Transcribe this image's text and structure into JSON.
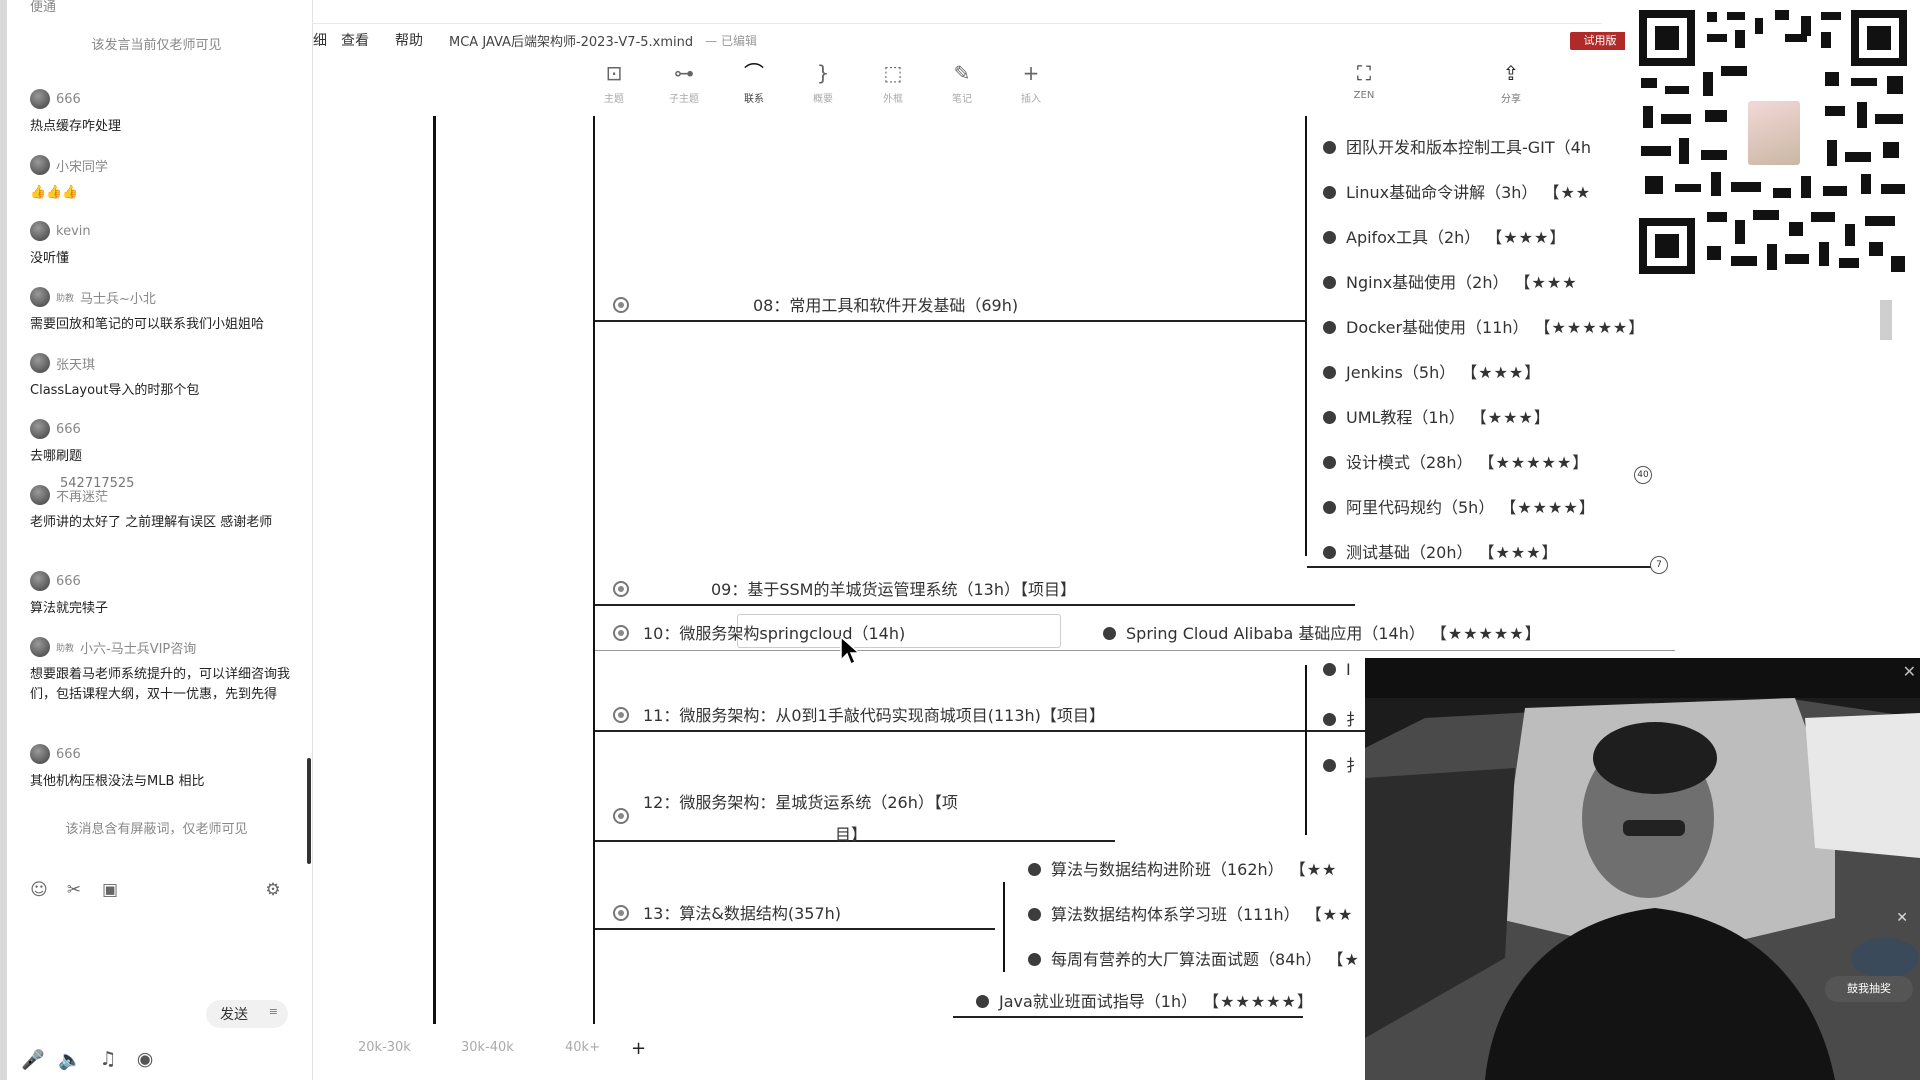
{
  "chat": {
    "notice_top": "该发言当前仅老师可见",
    "fragment_top": "便通",
    "messages": [
      {
        "user": "666",
        "tag": "",
        "text": "热点缓存咋处理"
      },
      {
        "user": "小宋同学",
        "tag": "",
        "text": "👍👍👍"
      },
      {
        "user": "kevin",
        "tag": "",
        "text": "没听懂"
      },
      {
        "user": "马士兵~小北",
        "tag": "助教",
        "text": "需要回放和笔记的可以联系我们小姐姐哈"
      },
      {
        "user": "张天琪",
        "tag": "",
        "text": "ClassLayout导入的时那个包"
      },
      {
        "user": "666",
        "tag": "",
        "text": "去哪刷题"
      },
      {
        "user": "不再迷茫",
        "tag": "",
        "text": "老师讲的太好了 之前理解有误区 感谢老师"
      },
      {
        "user": "666",
        "tag": "",
        "text": "算法就完犊子"
      },
      {
        "user": "小六-马士兵VIP咨询",
        "tag": "助教",
        "text": "想要跟着马老师系统提升的，可以详细咨询我们，包括课程大纲，双十一优惠，先到先得"
      },
      {
        "user": "666",
        "tag": "",
        "text": "其他机构压根没法与MLB 相比"
      }
    ],
    "overlap_number": "542717525",
    "notice_bottom": "该消息含有屏蔽词，仅老师可见",
    "send_label": "发送",
    "send_arrow": "≡",
    "emoji_icon": "☺",
    "scissors_icon": "✂",
    "image_icon": "▣",
    "settings_icon": "⚙",
    "mic_icon": "🎤",
    "speaker_icon": "🔈",
    "music_icon": "♫",
    "pin_icon": "◉"
  },
  "app": {
    "menu": [
      "查看",
      "帮助"
    ],
    "menu_fragment": "细",
    "doc_title": "MCA JAVA后端架构师-2023-V7-5.xmind",
    "doc_status": "— 已编辑",
    "trial_label": "试用版",
    "tools": [
      {
        "icon": "⊡",
        "label": "主题"
      },
      {
        "icon": "⊶",
        "label": "子主题"
      },
      {
        "icon": "⌒",
        "label": "联系"
      },
      {
        "icon": "}",
        "label": "概要"
      },
      {
        "icon": "⬚",
        "label": "外框"
      },
      {
        "icon": "✎",
        "label": "笔记"
      },
      {
        "icon": "+",
        "label": "插入"
      },
      {
        "icon": "⛶",
        "label": "ZEN"
      },
      {
        "icon": "⇪",
        "label": "分享"
      }
    ]
  },
  "mindmap": {
    "branches": [
      {
        "label": "08：常用工具和软件开发基础（69h)"
      },
      {
        "label": "09：基于SSM的羊城货运管理系统（13h）【项目】"
      },
      {
        "label": "10：微服务架构springcloud（14h)"
      },
      {
        "label": "11：微服务架构：从0到1手敲代码实现商城项目(113h)【项目】"
      },
      {
        "label": "12：微服务架构：星城货运系统（26h）【项"
      },
      {
        "label": "目】"
      },
      {
        "label": "13：算法&数据结构(357h)"
      }
    ],
    "tool_children": [
      {
        "label": "团队开发和版本控制工具-GIT（4h",
        "stars": ""
      },
      {
        "label": "Linux基础命令讲解（3h）",
        "stars": "【★★"
      },
      {
        "label": "Apifox工具（2h）",
        "stars": "【★★★】"
      },
      {
        "label": "Nginx基础使用（2h）",
        "stars": "【★★★"
      },
      {
        "label": "Docker基础使用（11h）",
        "stars": "【★★★★★】"
      },
      {
        "label": "Jenkins（5h）",
        "stars": "【★★★】"
      },
      {
        "label": "UML教程（1h）",
        "stars": "【★★★】"
      },
      {
        "label": "设计模式（28h）",
        "stars": "【★★★★★】"
      },
      {
        "label": "阿里代码规约（5h）",
        "stars": "【★★★★】"
      },
      {
        "label": "测试基础（20h）",
        "stars": "【★★★】"
      }
    ],
    "badge_a": "40",
    "badge_b": "7",
    "springcloud_child": {
      "label": "Spring Cloud Alibaba 基础应用（14h）",
      "stars": "【★★★★★】"
    },
    "clipped_children": [
      "I",
      "扌",
      "扌"
    ],
    "algo_children": [
      {
        "label": "算法与数据结构进阶班（162h）",
        "stars": "【★★"
      },
      {
        "label": "算法数据结构体系学习班（111h）",
        "stars": "【★★"
      },
      {
        "label": "每周有营养的大厂算法面试题（84h）",
        "stars": "【★"
      }
    ],
    "interview_child": {
      "label": "Java就业班面试指导（1h）",
      "stars": "【★★★★★】"
    }
  },
  "bottombar": {
    "tabs": [
      "20k-30k",
      "30k-40k",
      "40k+"
    ],
    "add": "+"
  },
  "video": {
    "close": "✕",
    "close2": "✕",
    "shirt_text": "鼓我抽奖"
  }
}
